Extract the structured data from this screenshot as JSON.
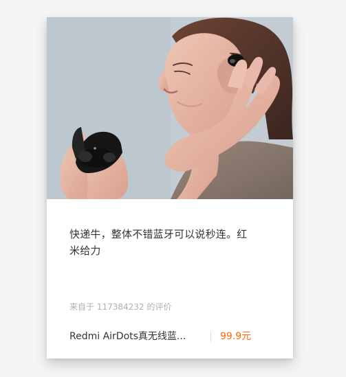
{
  "card": {
    "review": "快递牛，整体不错蓝牙可以说秒连。红\n米给力",
    "source": "来自于 117384232 的评价",
    "product_name": "Redmi AirDots真无线蓝...",
    "price": "99.9元"
  },
  "colors": {
    "price": "#ff6700",
    "text": "#333333",
    "muted": "#b0b0b0"
  }
}
